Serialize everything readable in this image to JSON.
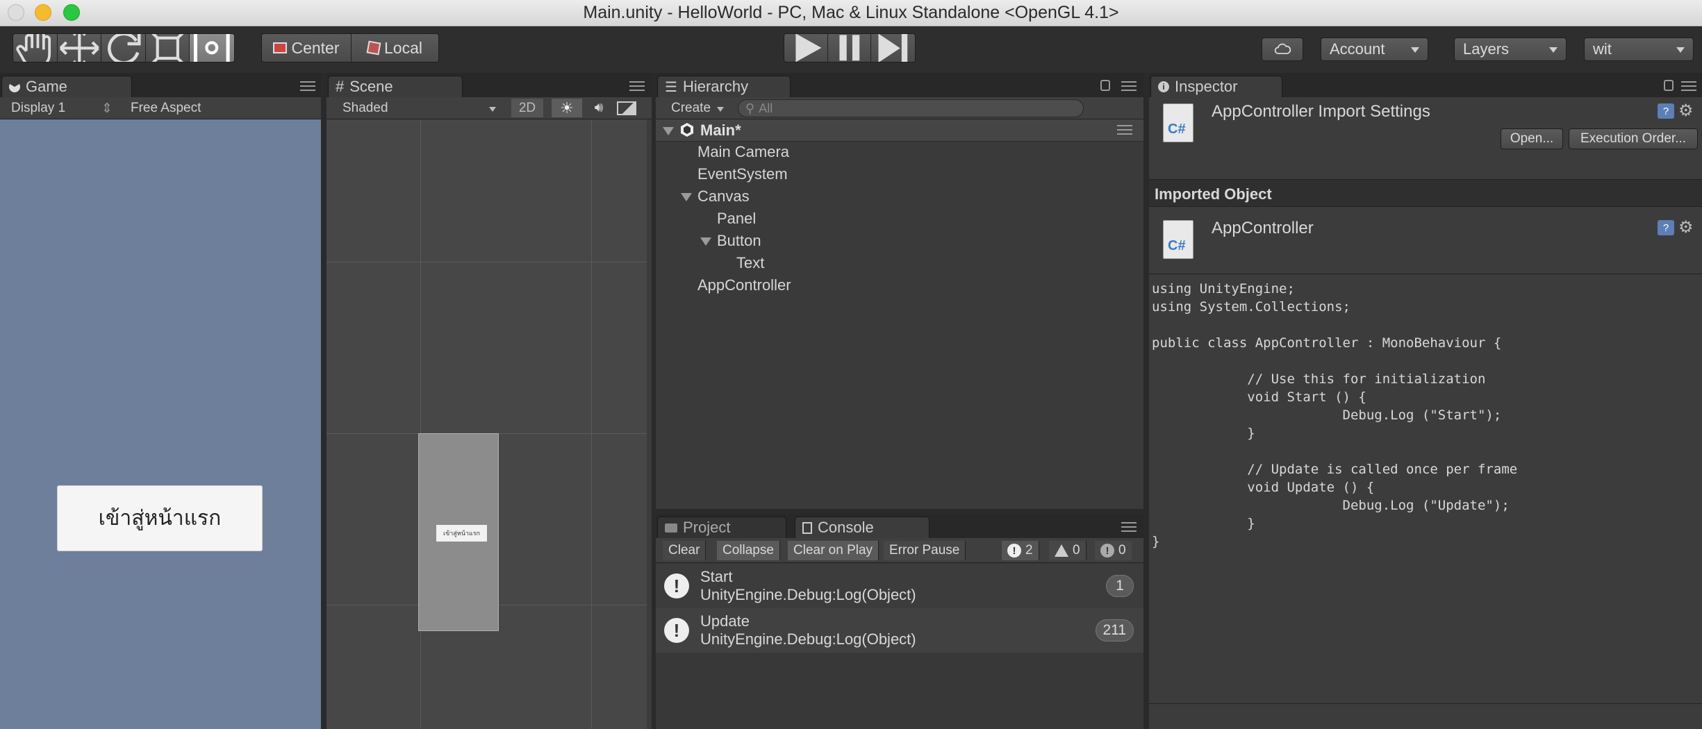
{
  "window": {
    "title": "Main.unity - HelloWorld - PC, Mac & Linux Standalone <OpenGL 4.1>"
  },
  "toolbar": {
    "tools": [
      "hand-tool",
      "move-tool",
      "rotate-tool",
      "scale-tool",
      "rect-tool"
    ],
    "pivot_center": "Center",
    "pivot_local": "Local",
    "account": "Account",
    "layers": "Layers",
    "layout": "wit"
  },
  "game": {
    "tab": "Game",
    "display": "Display 1",
    "aspect": "Free Aspect",
    "button_text": "เข้าสู่หน้าแรก"
  },
  "scene": {
    "tab": "Scene",
    "shading": "Shaded",
    "mode_2d": "2D",
    "button_text": "เข้าสู่หน้าแรก"
  },
  "hierarchy": {
    "tab": "Hierarchy",
    "create": "Create",
    "search_placeholder": "All",
    "root": "Main*",
    "items": [
      {
        "label": "Main Camera"
      },
      {
        "label": "EventSystem"
      },
      {
        "label": "Canvas"
      },
      {
        "label": "Panel"
      },
      {
        "label": "Button"
      },
      {
        "label": "Text"
      },
      {
        "label": "AppController"
      }
    ]
  },
  "console": {
    "tab_project": "Project",
    "tab_console": "Console",
    "buttons": {
      "clear": "Clear",
      "collapse": "Collapse",
      "clear_on_play": "Clear on Play",
      "error_pause": "Error Pause"
    },
    "counts": {
      "info": "2",
      "warnings": "0",
      "errors": "0"
    },
    "logs": [
      {
        "message": "Start",
        "source": "UnityEngine.Debug:Log(Object)",
        "count": "1"
      },
      {
        "message": "Update",
        "source": "UnityEngine.Debug:Log(Object)",
        "count": "211"
      }
    ]
  },
  "inspector": {
    "tab": "Inspector",
    "title": "AppController Import Settings",
    "open_button": "Open...",
    "execution_order_button": "Execution Order...",
    "section_header": "Imported Object",
    "object_name": "AppController",
    "file_icon_text": "C#",
    "code": "using UnityEngine;\nusing System.Collections;\n\npublic class AppController : MonoBehaviour {\n\n            // Use this for initialization\n            void Start () {\n                        Debug.Log (\"Start\");\n            }\n\n            // Update is called once per frame\n            void Update () {\n                        Debug.Log (\"Update\");\n            }\n}"
  }
}
